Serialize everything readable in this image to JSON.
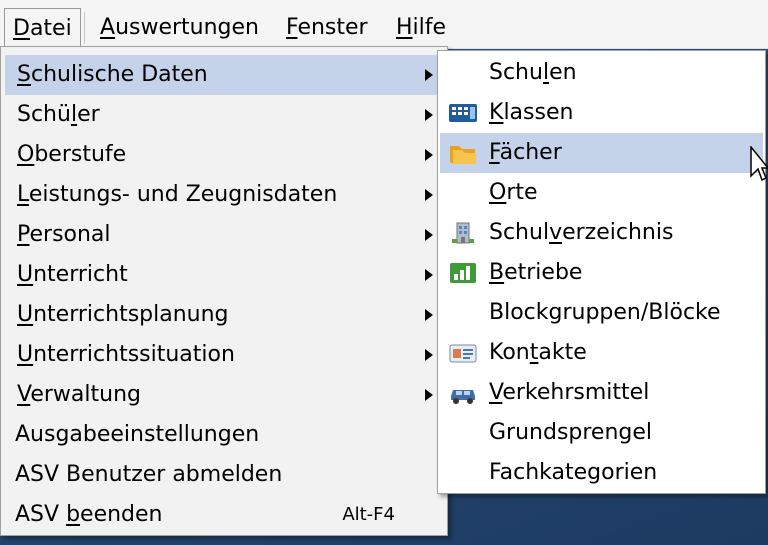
{
  "menubar": {
    "items": [
      {
        "label": "Datei",
        "u": "D",
        "rest": "atei"
      },
      {
        "label": "Auswertungen",
        "u": "A",
        "rest": "uswertungen"
      },
      {
        "label": "Fenster",
        "u": "F",
        "rest": "enster"
      },
      {
        "label": "Hilfe",
        "u": "H",
        "rest": "ilfe"
      }
    ]
  },
  "datei_menu": {
    "items": [
      {
        "pre": "",
        "u": "S",
        "post": "chulische Daten",
        "submenu": true
      },
      {
        "pre": "Schü",
        "u": "l",
        "post": "er",
        "submenu": true
      },
      {
        "pre": "",
        "u": "O",
        "post": "berstufe",
        "submenu": true
      },
      {
        "pre": "",
        "u": "L",
        "post": "eistungs- und Zeugnisdaten",
        "submenu": true
      },
      {
        "pre": "",
        "u": "P",
        "post": "ersonal",
        "submenu": true
      },
      {
        "pre": "",
        "u": "U",
        "post": "nterricht",
        "submenu": true
      },
      {
        "pre": "",
        "u": "U",
        "post": "nterrichtsplanung",
        "submenu": true
      },
      {
        "pre": "",
        "u": "U",
        "post": "nterrichtssituation",
        "submenu": true
      },
      {
        "pre": "",
        "u": "V",
        "post": "erwaltung",
        "submenu": true
      },
      {
        "pre": "Ausgabeeinstellungen",
        "u": "",
        "post": "",
        "submenu": false
      },
      {
        "pre": "ASV Benutzer abmelden",
        "u": "",
        "post": "",
        "submenu": false
      },
      {
        "pre": "ASV ",
        "u": "b",
        "post": "eenden",
        "submenu": false,
        "accel": "Alt-F4"
      }
    ]
  },
  "submenu": {
    "items": [
      {
        "pre": "Schu",
        "u": "l",
        "post": "en",
        "icon": ""
      },
      {
        "pre": "",
        "u": "K",
        "post": "lassen",
        "icon": "class-board-icon"
      },
      {
        "pre": "",
        "u": "F",
        "post": "ächer",
        "icon": "folder-icon"
      },
      {
        "pre": "",
        "u": "O",
        "post": "rte",
        "icon": ""
      },
      {
        "pre": "Schul",
        "u": "v",
        "post": "erzeichnis",
        "icon": "building-icon"
      },
      {
        "pre": "",
        "u": "B",
        "post": "etriebe",
        "icon": "bar-chart-icon"
      },
      {
        "pre": "Blockgruppen/Blöcke",
        "u": "",
        "post": "",
        "icon": ""
      },
      {
        "pre": "Kon",
        "u": "t",
        "post": "akte",
        "icon": "contact-card-icon"
      },
      {
        "pre": "",
        "u": "V",
        "post": "erkehrsmittel",
        "icon": "car-icon"
      },
      {
        "pre": "Grundsprengel",
        "u": "",
        "post": "",
        "icon": ""
      },
      {
        "pre": "Fachkategorien",
        "u": "",
        "post": "",
        "icon": ""
      }
    ]
  },
  "colors": {
    "highlight": "#c4d3ea",
    "menu_bg": "#f2f2f2",
    "desktop": "#2f4f7a"
  }
}
